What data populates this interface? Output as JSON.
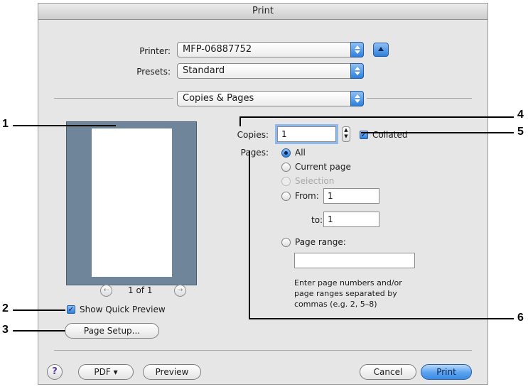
{
  "window": {
    "title": "Print"
  },
  "printer": {
    "label": "Printer:",
    "value": "MFP-06887752"
  },
  "presets": {
    "label": "Presets:",
    "value": "Standard"
  },
  "panel": {
    "value": "Copies & Pages"
  },
  "preview": {
    "page_indicator": "1 of 1",
    "prev_glyph": "⇠",
    "next_glyph": "⇢",
    "show_quick_preview_label": "Show Quick Preview",
    "page_setup_label": "Page Setup..."
  },
  "copies": {
    "label": "Copies:",
    "value": "1",
    "collated_label": "Collated"
  },
  "pages": {
    "label": "Pages:",
    "all_label": "All",
    "current_page_label": "Current page",
    "selection_label": "Selection",
    "from_label": "From:",
    "from_value": "1",
    "to_label": "to:",
    "to_value": "1",
    "page_range_label": "Page range:",
    "page_range_value": "",
    "hint_line1": "Enter page numbers and/or",
    "hint_line2": "page ranges separated by",
    "hint_line3": "commas (e.g. 2, 5–8)"
  },
  "footer": {
    "help_glyph": "?",
    "pdf_label": "PDF ▾",
    "preview_label": "Preview",
    "cancel_label": "Cancel",
    "print_label": "Print"
  },
  "callouts": [
    "1",
    "2",
    "3",
    "4",
    "5",
    "6"
  ],
  "colors": {
    "accent": "#3b8be6",
    "preview_bg": "#6f8599",
    "dialog_bg": "#e6e6e6"
  }
}
